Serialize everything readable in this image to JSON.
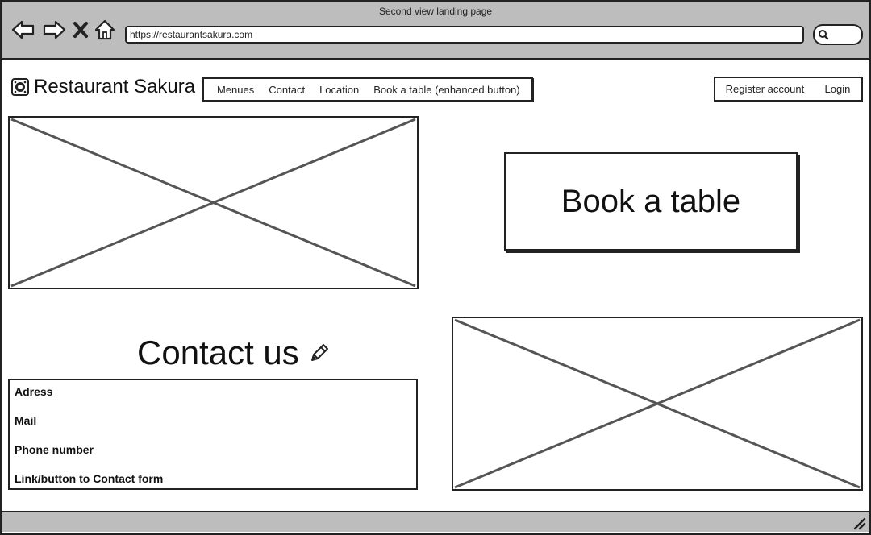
{
  "window": {
    "title": "Second view landing page"
  },
  "browser": {
    "url": "https://restaurantsakura.com"
  },
  "header": {
    "site_name": "Restaurant Sakura",
    "menu": [
      "Menues",
      "Contact",
      "Location",
      "Book a table (enhanced button)"
    ],
    "account": {
      "register_label": "Register account",
      "login_label": "Login"
    }
  },
  "main": {
    "book_button_label": "Book a table",
    "contact": {
      "title": "Contact us",
      "rows": [
        "Adress",
        "Mail",
        "Phone number",
        "Link/button to Contact form"
      ]
    }
  },
  "icons": {
    "back": "arrow-left-icon",
    "forward": "arrow-right-icon",
    "stop": "close-icon",
    "home": "home-icon",
    "search": "search-icon",
    "logo": "logo-icon",
    "edit": "pencil-icon",
    "resize": "resize-grip-icon"
  },
  "colors": {
    "chrome": "#bdbdbd",
    "stroke": "#222222",
    "placeholder_line": "#555555"
  }
}
